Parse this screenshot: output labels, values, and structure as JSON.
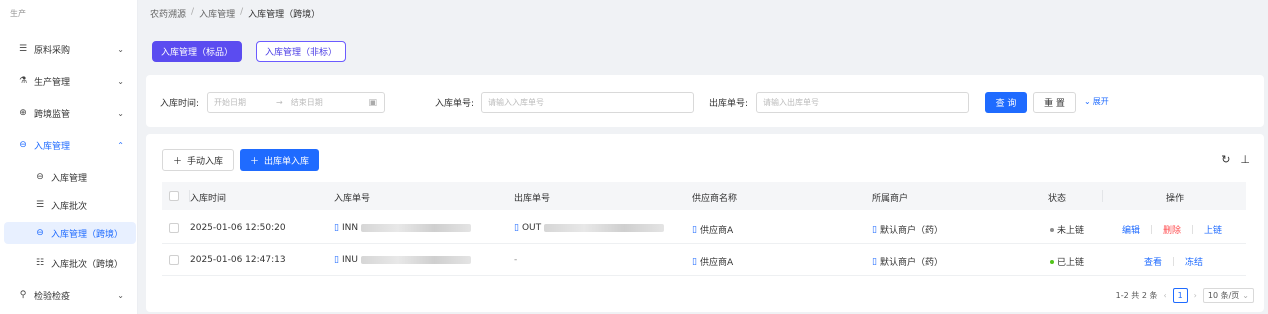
{
  "sidebar": {
    "heading": "生产",
    "items": [
      {
        "label": "原料采购",
        "icon": "list-icon"
      },
      {
        "label": "生产管理",
        "icon": "flask-icon"
      },
      {
        "label": "跨境监管",
        "icon": "globe-icon"
      },
      {
        "label": "入库管理",
        "icon": "inbound-icon"
      },
      {
        "label": "检验检疫",
        "icon": "microscope-icon"
      }
    ],
    "sub_items": [
      {
        "label": "入库管理",
        "icon": "inbound-icon"
      },
      {
        "label": "入库批次",
        "icon": "list-icon"
      },
      {
        "label": "入库管理（跨境）",
        "icon": "inbound-icon"
      },
      {
        "label": "入库批次（跨境）",
        "icon": "batch-icon"
      }
    ]
  },
  "breadcrumb": [
    "农药溯源",
    "入库管理",
    "入库管理（跨境）"
  ],
  "tabs": [
    {
      "label": "入库管理（标品）",
      "active": true
    },
    {
      "label": "入库管理（非标）",
      "active": false
    }
  ],
  "search": {
    "time_label": "入库时间:",
    "start_placeholder": "开始日期",
    "range_arrow": "→",
    "end_placeholder": "结束日期",
    "inbound_label": "入库单号:",
    "inbound_placeholder": "请输入入库单号",
    "outbound_label": "出库单号:",
    "outbound_placeholder": "请输入出库单号",
    "query_label": "查 询",
    "reset_label": "重 置",
    "expand_label": "展开"
  },
  "toolbar": {
    "manual_label": "手动入库",
    "outbound_in_label": "出库单入库"
  },
  "table": {
    "columns": [
      "入库时间",
      "入库单号",
      "出库单号",
      "供应商名称",
      "所属商户",
      "状态",
      "操作"
    ],
    "rows": [
      {
        "time": "2025-01-06 12:50:20",
        "inbound_no": "INN",
        "outbound_no": "OUT",
        "supplier": "供应商A",
        "merchant": "默认商户（药）",
        "status": "未上链",
        "status_color": "#8c8c8c",
        "actions": [
          "编辑",
          "删除",
          "上链"
        ]
      },
      {
        "time": "2025-01-06 12:47:13",
        "inbound_no": "INU",
        "outbound_no": "-",
        "supplier": "供应商A",
        "merchant": "默认商户（药）",
        "status": "已上链",
        "status_color": "#52c41a",
        "actions": [
          "查看",
          "冻结"
        ]
      }
    ]
  },
  "pagination": {
    "summary": "1-2 共 2 条",
    "current_page": "1",
    "page_size": "10 条/页"
  },
  "colors": {
    "primary": "#1f6bff",
    "tab_accent": "#5b4cf0",
    "danger": "#ff4d4f"
  }
}
